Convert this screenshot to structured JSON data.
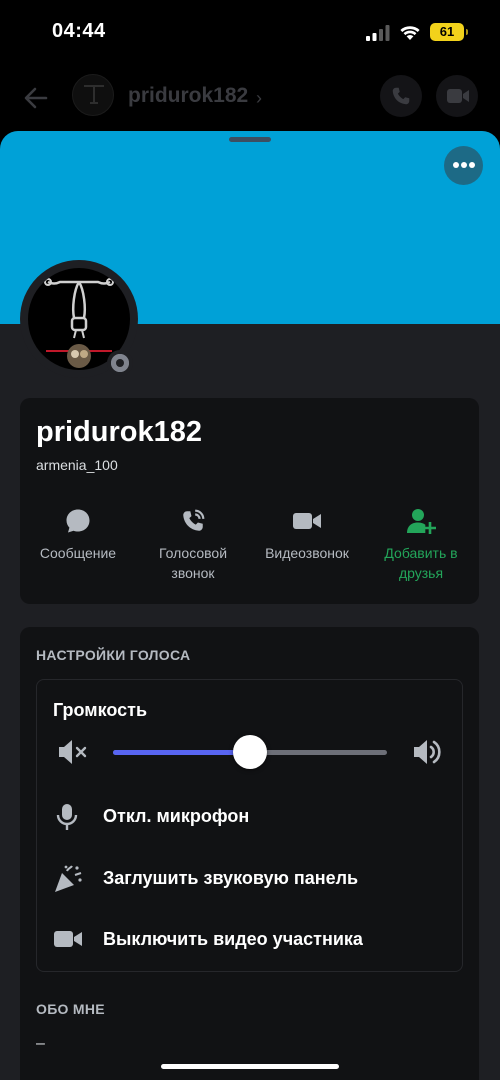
{
  "status_bar": {
    "time": "04:44",
    "battery": "61"
  },
  "header": {
    "name": "pridurok182",
    "chevron": "›"
  },
  "colors": {
    "banner": "#00a1d7",
    "accent": "#5865f2",
    "add_friend": "#23a55a"
  },
  "profile": {
    "display_name": "pridurok182",
    "username": "armenia_100",
    "status": "offline"
  },
  "actions": [
    {
      "label": "Сообщение",
      "icon": "chat-bubble-icon"
    },
    {
      "label": "Голосовой звонок",
      "icon": "phone-call-icon"
    },
    {
      "label": "Видеозвонок",
      "icon": "video-camera-icon"
    },
    {
      "label": "Добавить в друзья",
      "icon": "add-friend-icon"
    }
  ],
  "voice_settings": {
    "title": "НАСТРОЙКИ ГОЛОСА",
    "volume_label": "Громкость",
    "volume_level": 0.5,
    "options": [
      {
        "label": "Откл. микрофон",
        "icon": "microphone-icon"
      },
      {
        "label": "Заглушить звуковую панель",
        "icon": "party-popper-icon"
      },
      {
        "label": "Выключить видео участника",
        "icon": "video-camera-icon"
      }
    ]
  },
  "about": {
    "title": "ОБО МНЕ",
    "text": "–"
  }
}
